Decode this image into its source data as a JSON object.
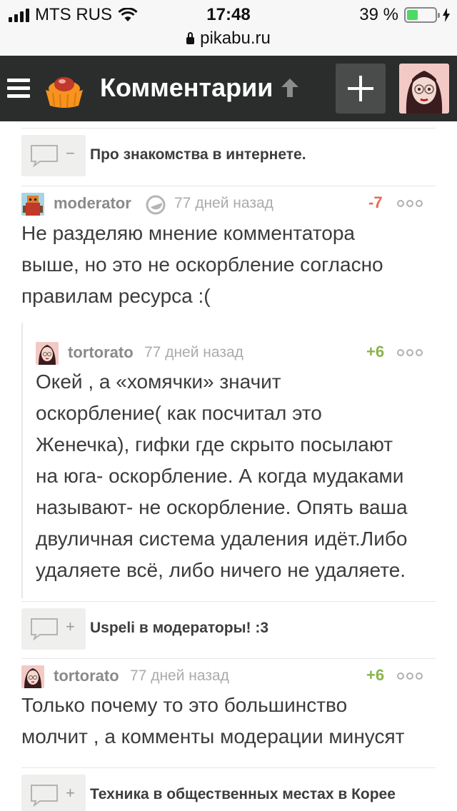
{
  "status_bar": {
    "carrier": "MTS RUS",
    "time": "17:48",
    "battery_label": "39 %",
    "battery_level": 0.39,
    "url": "pikabu.ru"
  },
  "header": {
    "title": "Комментарии",
    "icons": {
      "menu": "hamburger-icon",
      "logo": "pikabu-cupcake-logo",
      "sort": "arrow-up-icon",
      "add": "plus-icon"
    }
  },
  "comments": [
    {
      "kind": "collapsed",
      "toggle_sign": "−",
      "title": "Про знакомства в интернете."
    },
    {
      "kind": "full",
      "author": "moderator",
      "time": "77 дней назад",
      "rating": "-7",
      "text_lines": [
        "Не разделяю мнение комментатора",
        "выше, но это не оскорбление согласно",
        "правилам ресурса :("
      ]
    },
    {
      "kind": "reply",
      "author": "tortorato",
      "time": "77 дней назад",
      "rating": "+6",
      "text_lines": [
        "Окей , а «хомячки» значит",
        "оскорбление( как посчитал это",
        "Женечка), гифки где скрыто посылают",
        "на юга- оскорбление. А когда мудаками",
        "называют- не оскорбление. Опять ваша",
        "двуличная система удаления идёт.Либо",
        "удаляете всё, либо ничего не удаляете."
      ]
    },
    {
      "kind": "collapsed",
      "toggle_sign": "+",
      "title": "Uspeli в модераторы! :3"
    },
    {
      "kind": "full",
      "author": "tortorato",
      "time": "77 дней назад",
      "rating": "+6",
      "text_lines": [
        "Только почему то это большинство",
        "молчит , а комменты модерации минусят"
      ]
    },
    {
      "kind": "collapsed",
      "toggle_sign": "+",
      "title": "Техника в общественных местах в Корее"
    }
  ]
}
